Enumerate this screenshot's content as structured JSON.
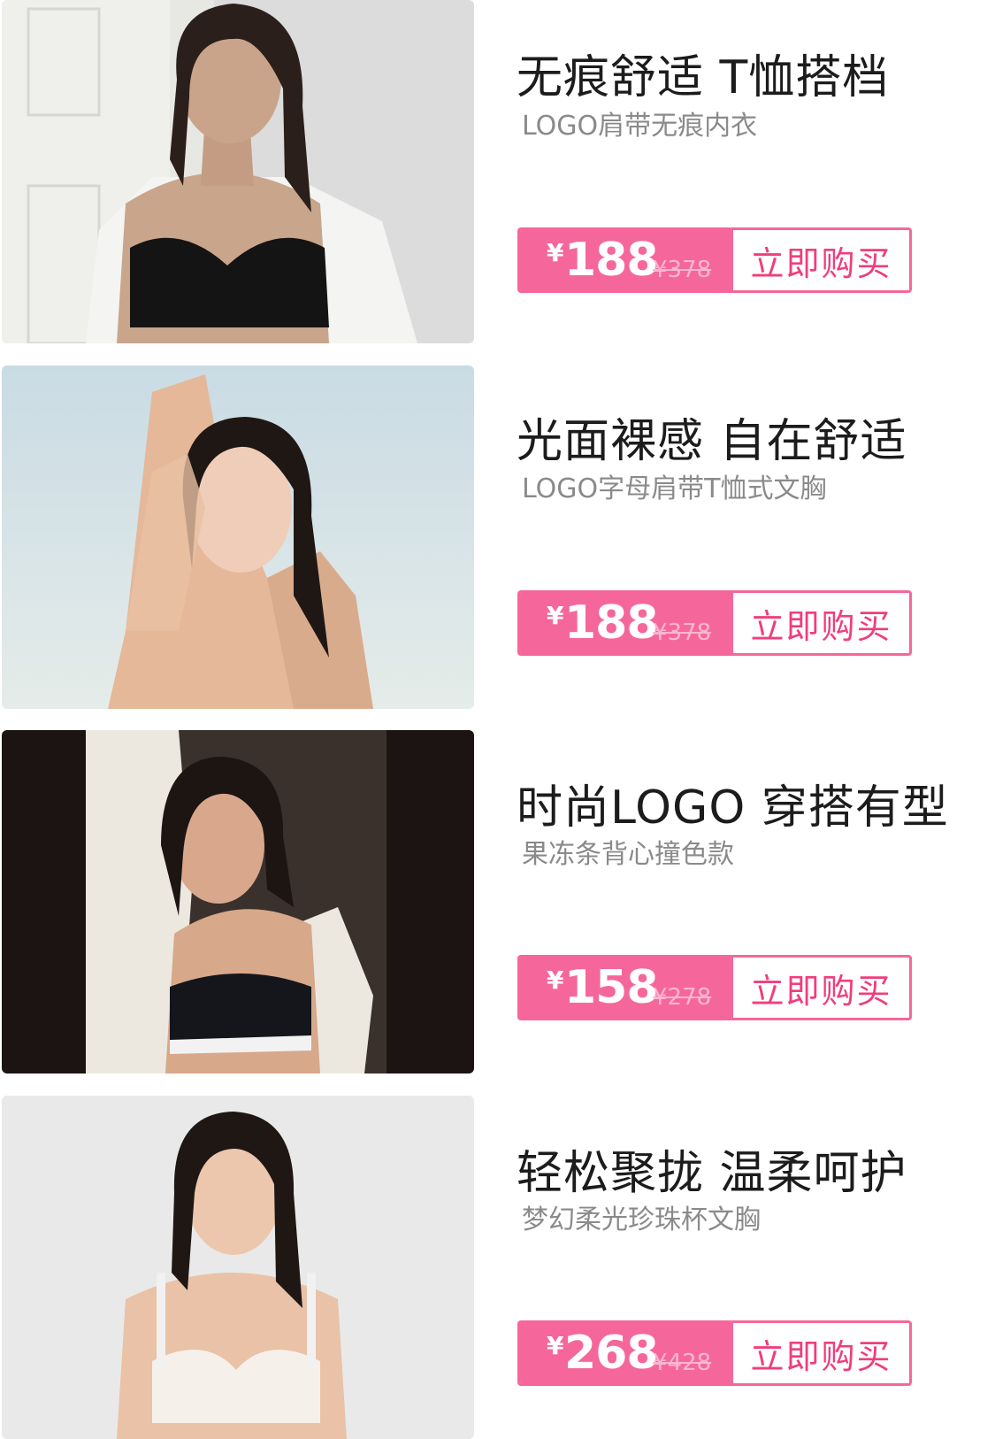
{
  "colors": {
    "accent": "#f5679a",
    "buy_text": "#f03d7d",
    "title": "#1c1c1c",
    "subtitle": "#8a8a8a"
  },
  "products": [
    {
      "title": "无痕舒适 T恤搭档",
      "subtitle": "LOGO肩带无痕内衣",
      "currency": "¥",
      "price": "188",
      "original_price": "¥378",
      "buy_label": "立即购买"
    },
    {
      "title": "光面裸感 自在舒适",
      "subtitle": "LOGO字母肩带T恤式文胸",
      "currency": "¥",
      "price": "188",
      "original_price": "¥378",
      "buy_label": "立即购买"
    },
    {
      "title": "时尚LOGO 穿搭有型",
      "subtitle": "果冻条背心撞色款",
      "currency": "¥",
      "price": "158",
      "original_price": "¥278",
      "buy_label": "立即购买"
    },
    {
      "title": "轻松聚拢 温柔呵护",
      "subtitle": "梦幻柔光珍珠杯文胸",
      "currency": "¥",
      "price": "268",
      "original_price": "¥428",
      "buy_label": "立即购买"
    }
  ]
}
